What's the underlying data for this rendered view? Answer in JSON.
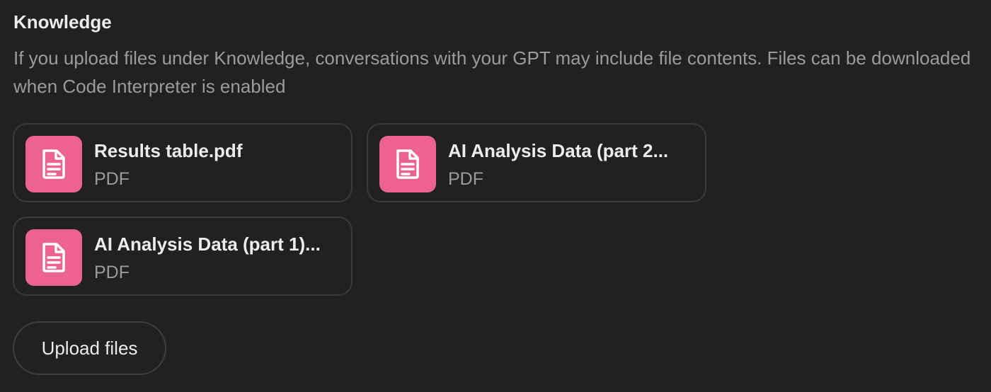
{
  "knowledge": {
    "title": "Knowledge",
    "description": "If you upload files under Knowledge, conversations with your GPT may include file contents. Files can be downloaded when Code Interpreter is enabled",
    "files": [
      {
        "name": "Results table.pdf",
        "type": "PDF",
        "icon": "document-icon"
      },
      {
        "name": "AI Analysis Data (part 2...",
        "type": "PDF",
        "icon": "document-icon"
      },
      {
        "name": "AI Analysis Data (part 1)...",
        "type": "PDF",
        "icon": "document-icon"
      }
    ],
    "upload_label": "Upload files"
  },
  "colors": {
    "background": "#212121",
    "file_icon_bg": "#ec6391",
    "text_primary": "#ececec",
    "text_secondary": "#9b9b9b",
    "border": "#3a3a3a"
  }
}
